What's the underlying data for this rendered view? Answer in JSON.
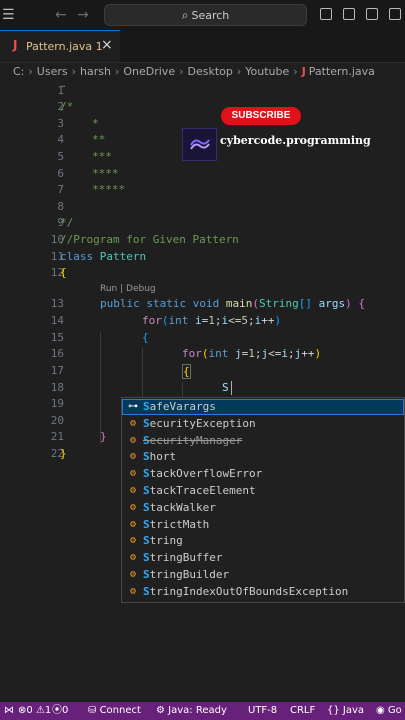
{
  "titlebar": {
    "search_label": "Search"
  },
  "tab": {
    "label": "Pattern.java 1"
  },
  "breadcrumb": [
    "C:",
    "Users",
    "harsh",
    "OneDrive",
    "Desktop",
    "Youtube",
    "Pattern.java"
  ],
  "overlay": {
    "subscribe": "SUBSCRIBE",
    "channel": "cybercode.programming"
  },
  "editor": {
    "lines": [
      "1",
      "2",
      "3",
      "4",
      "5",
      "6",
      "7",
      "8",
      "9",
      "10",
      "11",
      "12",
      "13",
      "14",
      "15",
      "16",
      "17",
      "18",
      "19",
      "20",
      "21",
      "22"
    ],
    "codelens": "Run | Debug",
    "comment_title": "//Program for Given Pattern"
  },
  "suggestions": [
    {
      "icon": "key",
      "prefix": "S",
      "rest": "afeVarargs",
      "deprecated": false,
      "selected": true
    },
    {
      "icon": "class",
      "prefix": "S",
      "rest": "ecurityException",
      "deprecated": false,
      "selected": false
    },
    {
      "icon": "class",
      "prefix": "S",
      "rest": "ecurityManager",
      "deprecated": true,
      "selected": false
    },
    {
      "icon": "class",
      "prefix": "S",
      "rest": "hort",
      "deprecated": false,
      "selected": false
    },
    {
      "icon": "class",
      "prefix": "S",
      "rest": "tackOverflowError",
      "deprecated": false,
      "selected": false
    },
    {
      "icon": "class",
      "prefix": "S",
      "rest": "tackTraceElement",
      "deprecated": false,
      "selected": false
    },
    {
      "icon": "class",
      "prefix": "S",
      "rest": "tackWalker",
      "deprecated": false,
      "selected": false
    },
    {
      "icon": "class",
      "prefix": "S",
      "rest": "trictMath",
      "deprecated": false,
      "selected": false
    },
    {
      "icon": "class",
      "prefix": "S",
      "rest": "tring",
      "deprecated": false,
      "selected": false
    },
    {
      "icon": "class",
      "prefix": "S",
      "rest": "tringBuffer",
      "deprecated": false,
      "selected": false
    },
    {
      "icon": "class",
      "prefix": "S",
      "rest": "tringBuilder",
      "deprecated": false,
      "selected": false
    },
    {
      "icon": "class",
      "prefix": "S",
      "rest": "tringIndexOutOfBoundsException",
      "deprecated": false,
      "selected": false
    }
  ],
  "statusbar": {
    "errors": "0",
    "warnings": "1",
    "ports": "0",
    "connect": "Connect",
    "java_status": "Java: Ready",
    "encoding": "UTF-8",
    "eol": "CRLF",
    "language": "Java",
    "go_live": "Go"
  },
  "colors": {
    "statusbar": "#68217a",
    "accent": "#0078d4",
    "subscribe": "#e1111a"
  }
}
